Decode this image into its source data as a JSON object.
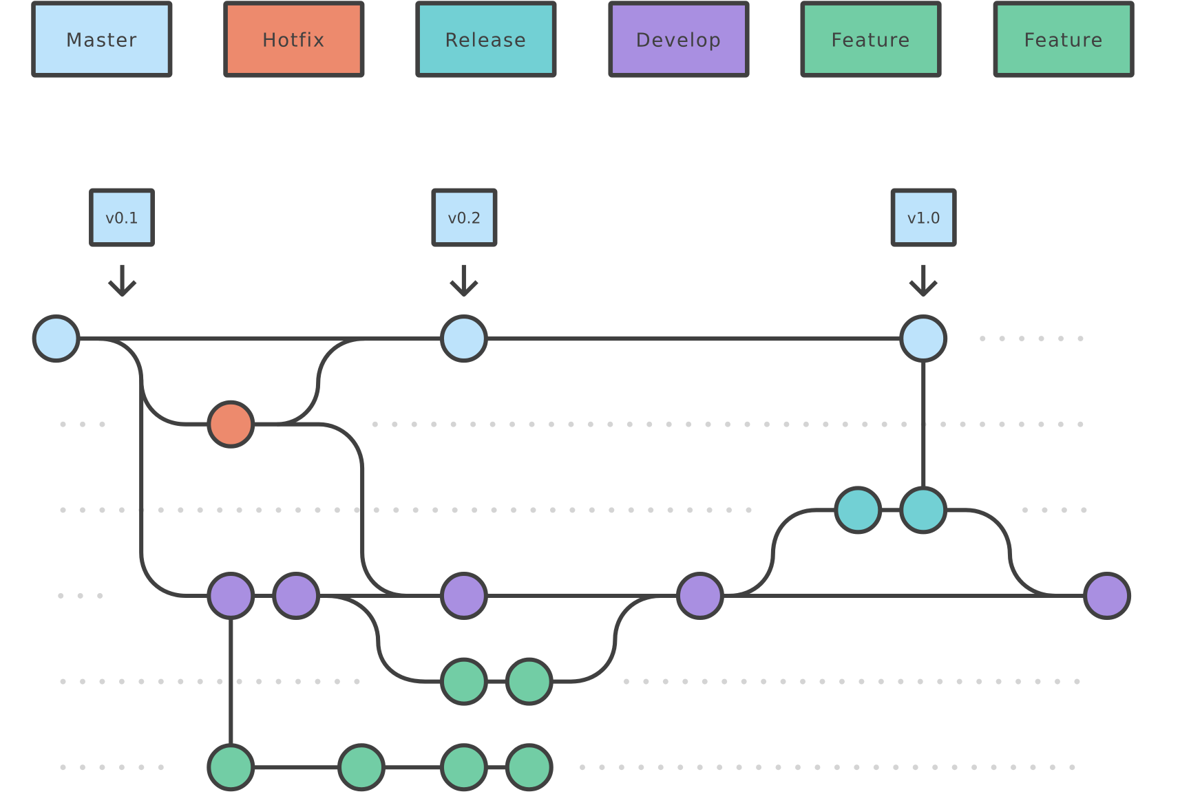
{
  "legend": [
    {
      "label": "Master",
      "branch": "master"
    },
    {
      "label": "Hotfix",
      "branch": "hotfix"
    },
    {
      "label": "Release",
      "branch": "release"
    },
    {
      "label": "Develop",
      "branch": "develop"
    },
    {
      "label": "Feature",
      "branch": "feature"
    },
    {
      "label": "Feature",
      "branch": "feature"
    }
  ],
  "colors": {
    "master": "#bde3fb",
    "hotfix": "#ed8a6d",
    "release": "#72d0d4",
    "develop": "#a98fe1",
    "feature": "#72cda5",
    "stroke": "#404040",
    "placeholder_dot": "#d4d4d4"
  },
  "tags": [
    {
      "label": "v0.1",
      "commit": "master-1"
    },
    {
      "label": "v0.2",
      "commit": "master-2"
    },
    {
      "label": "v1.0",
      "commit": "master-3"
    }
  ],
  "branches": [
    {
      "name": "master",
      "commits": [
        "master-1",
        "master-2",
        "master-3"
      ]
    },
    {
      "name": "hotfix",
      "commits": [
        "hotfix-1"
      ]
    },
    {
      "name": "release",
      "commits": [
        "release-1",
        "release-2"
      ]
    },
    {
      "name": "develop",
      "commits": [
        "develop-1",
        "develop-2",
        "develop-3",
        "develop-4",
        "develop-5"
      ]
    },
    {
      "name": "feature-a",
      "color_key": "feature",
      "commits": [
        "feature-a-1",
        "feature-a-2"
      ]
    },
    {
      "name": "feature-b",
      "color_key": "feature",
      "commits": [
        "feature-b-1",
        "feature-b-2",
        "feature-b-3",
        "feature-b-4"
      ]
    }
  ]
}
